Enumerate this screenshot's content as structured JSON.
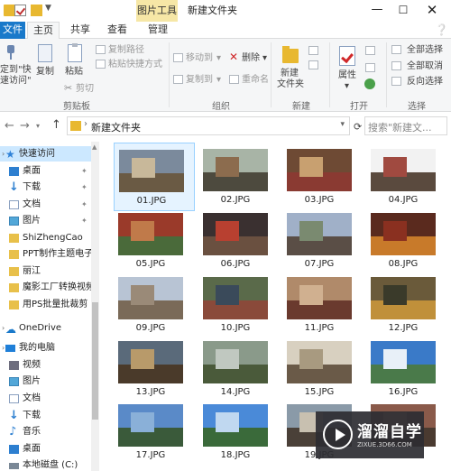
{
  "window": {
    "title": "新建文件夹",
    "context_tab": "图片工具",
    "minimize_glyph": "—",
    "maximize_glyph": "☐",
    "close_glyph": "✕"
  },
  "tabs": {
    "file": "文件",
    "home": "主页",
    "share": "共享",
    "view": "查看",
    "manage": "管理"
  },
  "ribbon": {
    "clipboard": {
      "pin_line1": "定到\"快",
      "pin_line2": "速访问\"",
      "copy": "复制",
      "paste": "粘贴",
      "copy_path": "复制路径",
      "paste_shortcut": "粘贴快捷方式",
      "cut": "剪切",
      "group": "剪贴板"
    },
    "organize": {
      "move_to": "移动到",
      "copy_to": "复制到",
      "delete": "删除",
      "rename": "重命名",
      "group": "组织"
    },
    "new": {
      "new_folder_line1": "新建",
      "new_folder_line2": "文件夹",
      "group": "新建"
    },
    "open": {
      "properties": "属性",
      "group": "打开"
    },
    "select": {
      "select_all": "全部选择",
      "select_none": "全部取消",
      "invert": "反向选择",
      "group": "选择"
    }
  },
  "address": {
    "back": "←",
    "forward": "→",
    "up": "↑",
    "path": "新建文件夹",
    "search_placeholder": "搜索\"新建文..."
  },
  "navigation": [
    {
      "label": "快速访问",
      "icon": "star-icon",
      "pinned": false,
      "selected": true,
      "indent": 0
    },
    {
      "label": "桌面",
      "icon": "desktop-icon",
      "pinned": true,
      "selected": false,
      "indent": 1
    },
    {
      "label": "下载",
      "icon": "download-icon",
      "pinned": true,
      "selected": false,
      "indent": 1
    },
    {
      "label": "文档",
      "icon": "documents-icon",
      "pinned": true,
      "selected": false,
      "indent": 1
    },
    {
      "label": "图片",
      "icon": "pictures-icon",
      "pinned": true,
      "selected": false,
      "indent": 1
    },
    {
      "label": "ShiZhengCao",
      "icon": "folder-icon",
      "pinned": false,
      "selected": false,
      "indent": 1
    },
    {
      "label": "PPT制作主题电子书",
      "icon": "folder-icon",
      "pinned": false,
      "selected": false,
      "indent": 1
    },
    {
      "label": "丽江",
      "icon": "folder-icon",
      "pinned": false,
      "selected": false,
      "indent": 1
    },
    {
      "label": "魔影工厂转换视频",
      "icon": "folder-icon",
      "pinned": false,
      "selected": false,
      "indent": 1
    },
    {
      "label": "用PS批量批裁剪",
      "icon": "folder-icon",
      "pinned": false,
      "selected": false,
      "indent": 1
    },
    {
      "label": "OneDrive",
      "icon": "cloud-icon",
      "pinned": false,
      "selected": false,
      "indent": 0
    },
    {
      "label": "我的电脑",
      "icon": "computer-icon",
      "pinned": false,
      "selected": false,
      "indent": 0
    },
    {
      "label": "视频",
      "icon": "videos-icon",
      "pinned": false,
      "selected": false,
      "indent": 1
    },
    {
      "label": "图片",
      "icon": "pictures-icon",
      "pinned": false,
      "selected": false,
      "indent": 1
    },
    {
      "label": "文档",
      "icon": "documents-icon",
      "pinned": false,
      "selected": false,
      "indent": 1
    },
    {
      "label": "下载",
      "icon": "download-icon",
      "pinned": false,
      "selected": false,
      "indent": 1
    },
    {
      "label": "音乐",
      "icon": "music-icon",
      "pinned": false,
      "selected": false,
      "indent": 1
    },
    {
      "label": "桌面",
      "icon": "desktop-icon",
      "pinned": false,
      "selected": false,
      "indent": 1
    },
    {
      "label": "本地磁盘 (C:)",
      "icon": "drive-icon",
      "pinned": false,
      "selected": false,
      "indent": 1
    }
  ],
  "files": [
    {
      "name": "01.JPG",
      "colors": [
        "#7b8a9c",
        "#6a5a44",
        "#c8b89a"
      ],
      "selected": true
    },
    {
      "name": "02.JPG",
      "colors": [
        "#a8b4a6",
        "#4d4a3e",
        "#8c6c4e"
      ],
      "selected": false
    },
    {
      "name": "03.JPG",
      "colors": [
        "#6e4a34",
        "#8a3a32",
        "#c8a070"
      ],
      "selected": false
    },
    {
      "name": "04.JPG",
      "colors": [
        "#f2f2f2",
        "#5a4a3e",
        "#a04a40"
      ],
      "selected": false
    },
    {
      "name": "05.JPG",
      "colors": [
        "#9a3a2a",
        "#4a6a3a",
        "#c07a4a"
      ],
      "selected": false
    },
    {
      "name": "06.JPG",
      "colors": [
        "#3a3030",
        "#6a5040",
        "#b84030"
      ],
      "selected": false
    },
    {
      "name": "07.JPG",
      "colors": [
        "#a0b0c8",
        "#5a4e46",
        "#7a8a70"
      ],
      "selected": false
    },
    {
      "name": "08.JPG",
      "colors": [
        "#5a2a1e",
        "#c87a2a",
        "#8a3020"
      ],
      "selected": false
    },
    {
      "name": "09.JPG",
      "colors": [
        "#b8c4d4",
        "#7a6a58",
        "#9a8a78"
      ],
      "selected": false
    },
    {
      "name": "10.JPG",
      "colors": [
        "#5a6a4a",
        "#8a4a3a",
        "#3a4a5a"
      ],
      "selected": false
    },
    {
      "name": "11.JPG",
      "colors": [
        "#b08a6a",
        "#6a3a2e",
        "#d0b090"
      ],
      "selected": false
    },
    {
      "name": "12.JPG",
      "colors": [
        "#6a5a3a",
        "#c0903a",
        "#3a3a2a"
      ],
      "selected": false
    },
    {
      "name": "13.JPG",
      "colors": [
        "#5a6a7a",
        "#4a3a2a",
        "#b89a6a"
      ],
      "selected": false
    },
    {
      "name": "14.JPG",
      "colors": [
        "#8a9a8a",
        "#4a5a3a",
        "#c0c8c0"
      ],
      "selected": false
    },
    {
      "name": "15.JPG",
      "colors": [
        "#d8d0c0",
        "#6a5a48",
        "#a89a80"
      ],
      "selected": false
    },
    {
      "name": "16.JPG",
      "colors": [
        "#3a7ac8",
        "#4a7a4a",
        "#e8f0f8"
      ],
      "selected": false
    },
    {
      "name": "17.JPG",
      "colors": [
        "#5a8ac8",
        "#3a5a3a",
        "#8ab0d8"
      ],
      "selected": false
    },
    {
      "name": "18.JPG",
      "colors": [
        "#4a8ad8",
        "#3a6a3a",
        "#c0d8f0"
      ],
      "selected": false
    },
    {
      "name": "19.JPG",
      "colors": [
        "#8a9aa8",
        "#4a4038",
        "#c8c0b0"
      ],
      "selected": false
    },
    {
      "name": "",
      "colors": [
        "#8a5a4a",
        "#4a3a30",
        "#c09070"
      ],
      "selected": false
    }
  ],
  "watermark": {
    "title": "溜溜自学",
    "url": "ZIXUE.3D66.COM"
  }
}
